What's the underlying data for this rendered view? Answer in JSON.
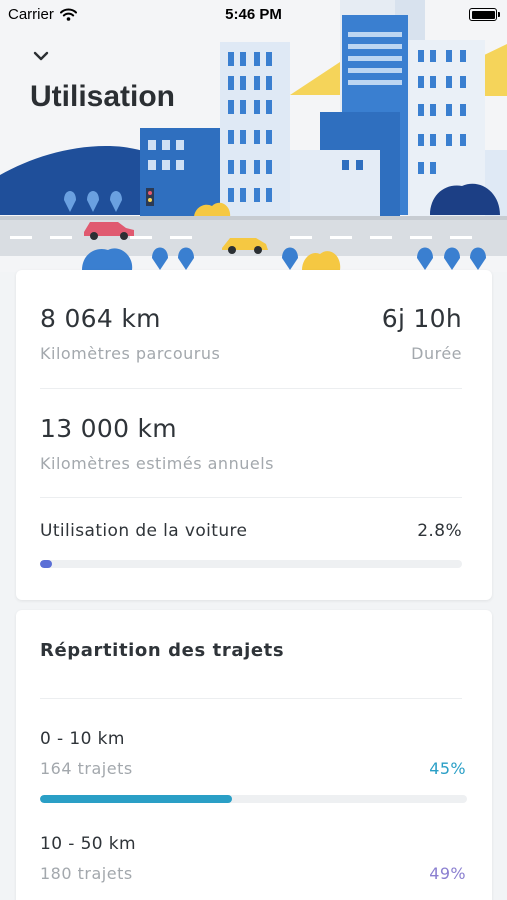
{
  "status_bar": {
    "carrier": "Carrier",
    "time": "5:46 PM"
  },
  "header": {
    "title": "Utilisation"
  },
  "stats": {
    "distance_value": "8 064 km",
    "distance_label": "Kilomètres parcourus",
    "duration_value": "6j 10h",
    "duration_label": "Durée",
    "annual_value": "13 000 km",
    "annual_label": "Kilomètres estimés annuels",
    "usage_label": "Utilisation de la voiture",
    "usage_pct": "2.8%",
    "usage_fraction": 0.028
  },
  "trips": {
    "title": "Répartition des trajets",
    "rows": [
      {
        "range": "0 - 10 km",
        "count": "164 trajets",
        "pct": "45%",
        "fraction": 0.45,
        "color": "#2a9fc6"
      },
      {
        "range": "10 - 50 km",
        "count": "180 trajets",
        "pct": "49%",
        "fraction": 0.49,
        "color": "#8a7fd0"
      }
    ]
  },
  "colors": {
    "accent_blue": "#2a9fc6",
    "accent_purple": "#8a7fd0",
    "usage_bar": "#5b6fd6"
  }
}
